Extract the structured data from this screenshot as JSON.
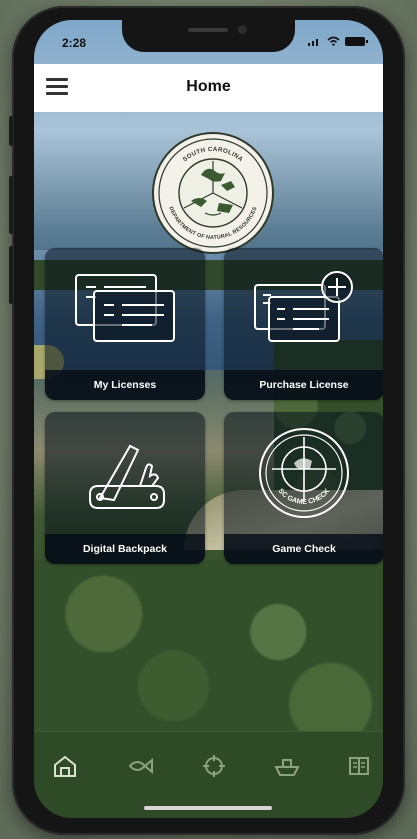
{
  "status_bar": {
    "time": "2:28"
  },
  "header": {
    "title": "Home",
    "menu_icon": "hamburger-menu-icon"
  },
  "seal": {
    "icon": "scdnr-seal-logo",
    "text_top": "SOUTH CAROLINA",
    "text_bottom": "DEPARTMENT OF NATURAL RESOURCES"
  },
  "tiles": [
    {
      "label": "My Licenses",
      "icon": "license-cards-icon"
    },
    {
      "label": "Purchase License",
      "icon": "license-add-icon"
    },
    {
      "label": "Digital Backpack",
      "icon": "pocket-knife-icon"
    },
    {
      "label": "Game Check",
      "icon": "game-check-crosshair-icon",
      "badge_text": "SC GAME CHECK"
    }
  ],
  "tabbar": {
    "items": [
      {
        "name": "home",
        "icon": "home-icon",
        "active": true
      },
      {
        "name": "fishing",
        "icon": "fish-icon"
      },
      {
        "name": "hunting",
        "icon": "crosshair-icon"
      },
      {
        "name": "boating",
        "icon": "boat-icon"
      },
      {
        "name": "regulations",
        "icon": "book-icon"
      }
    ]
  },
  "colors": {
    "header_bg": "#ffffff",
    "tile_overlay": "#0a1420",
    "tabbar_bg": "#2f4a27",
    "icon_stroke": "#ffffff"
  }
}
